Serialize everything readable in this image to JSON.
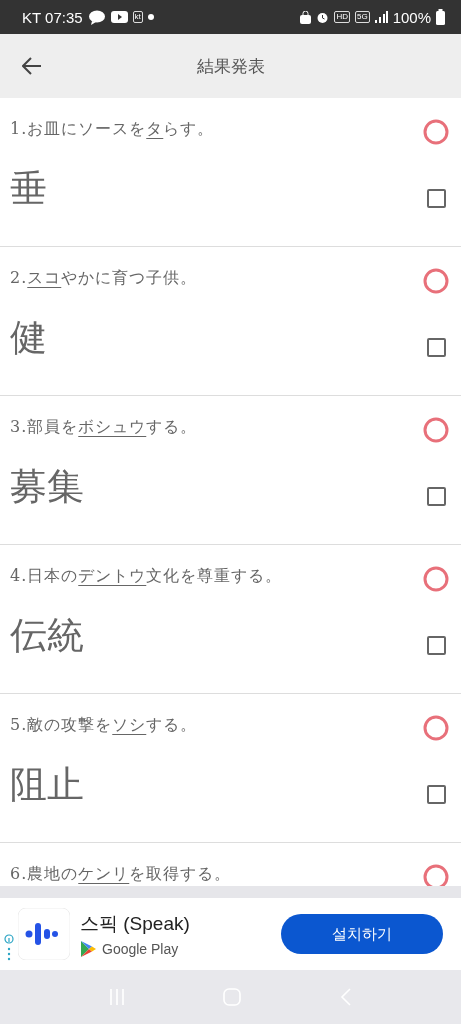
{
  "status_bar": {
    "carrier_time": "KT 07:35",
    "kt_badge": "kt",
    "hd_badge": "HD",
    "network": "5G",
    "battery": "100%"
  },
  "header": {
    "title": "結果発表"
  },
  "questions": [
    {
      "number": "1.",
      "before": "お皿にソースを",
      "underlined": "タ",
      "after": "らす。",
      "answer": "垂",
      "correct": true,
      "checked": false
    },
    {
      "number": "2.",
      "underlined": "スコ",
      "after": "やかに育つ子供。",
      "answer": "健",
      "correct": true,
      "checked": false
    },
    {
      "number": "3.",
      "before": "部員を",
      "underlined": "ボシュウ",
      "after": "する。",
      "answer": "募集",
      "correct": true,
      "checked": false
    },
    {
      "number": "4.",
      "before": "日本の",
      "underlined": "デントウ",
      "after": "文化を尊重する。",
      "answer": "伝統",
      "correct": true,
      "checked": false
    },
    {
      "number": "5.",
      "before": "敵の攻撃を",
      "underlined": "ソシ",
      "after": "する。",
      "answer": "阻止",
      "correct": true,
      "checked": false
    },
    {
      "number": "6.",
      "before": "農地の",
      "underlined": "ケンリ",
      "after": "を取得する。",
      "correct": true
    }
  ],
  "ad": {
    "app_name": "스픽 (Speak)",
    "store": "Google Play",
    "button": "설치하기"
  }
}
